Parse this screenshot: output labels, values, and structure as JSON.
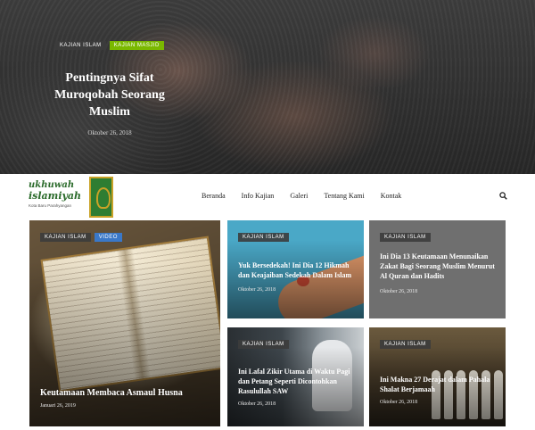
{
  "hero": {
    "categories": [
      "KAJIAN ISLAM",
      "KAJIAN MASJID"
    ],
    "title": "Pentingnya Sifat Muroqobah Seorang Muslim",
    "date": "Oktober 26, 2018"
  },
  "logo": {
    "line1": "ukhuwah",
    "line2": "islamiyah",
    "tagline": "Kota Baru Parahyangan"
  },
  "nav": {
    "items": [
      "Beranda",
      "Info Kajian",
      "Galeri",
      "Tentang Kami",
      "Kontak"
    ]
  },
  "cards": [
    {
      "categories": [
        "KAJIAN ISLAM",
        "VIDEO"
      ],
      "title": "Keutamaan Membaca Asmaul Husna",
      "date": "Januari 26, 2019"
    },
    {
      "categories": [
        "KAJIAN ISLAM"
      ],
      "title": "Yuk Bersedekah! Ini Dia 12 Hikmah dan Keajaiban Sedekah Dalam Islam",
      "date": "Oktober 26, 2018"
    },
    {
      "categories": [
        "KAJIAN ISLAM"
      ],
      "title": "Ini Dia 13 Keutamaan Menunaikan Zakat Bagi Seorang Muslim Menurut Al Quran dan Hadits",
      "date": "Oktober 26, 2018"
    },
    {
      "categories": [
        "KAJIAN ISLAM"
      ],
      "title": "Ini Lafal Zikir Utama di Waktu Pagi dan Petang Seperti Dicontohkan Rasulullah SAW",
      "date": "Oktober 26, 2018"
    },
    {
      "categories": [
        "KAJIAN ISLAM"
      ],
      "title": "Ini Makna 27 Derajat dalam Pahala Shalat Berjamaah",
      "date": "Oktober 26, 2018"
    }
  ],
  "colors": {
    "accent_green": "#7ab800",
    "video_blue": "#3a78c8",
    "logo_green": "#2e7d32"
  }
}
